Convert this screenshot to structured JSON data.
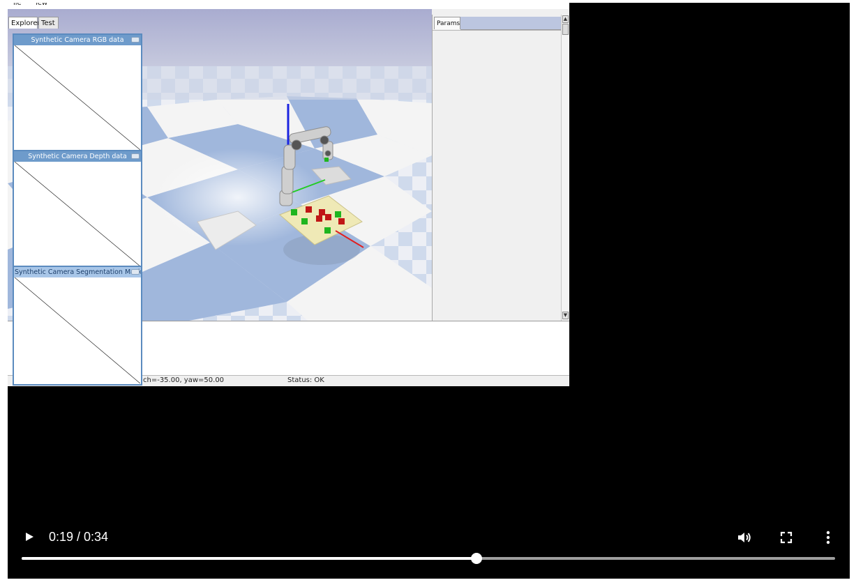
{
  "app": {
    "menu": [
      "ile",
      "iew"
    ],
    "tabs": [
      "Explorer",
      "Test"
    ],
    "params_tab": "Params",
    "status_camera": "ch=-35.00, yaw=50.00",
    "status_text": "Status: OK",
    "camera_windows": [
      {
        "title": "Synthetic Camera RGB data"
      },
      {
        "title": "Synthetic Camera Depth data"
      },
      {
        "title": "Synthetic Camera Segmentation Mask"
      }
    ]
  },
  "video": {
    "time_display": "0:19 / 0:34",
    "current_time": "0:19",
    "duration": "0:34",
    "progress_fraction": 0.559,
    "icons": {
      "play": "play-icon",
      "volume": "volume-icon",
      "fullscreen": "fullscreen-icon",
      "more": "more-vert-icon"
    }
  },
  "colors": {
    "sky": "#b3b6d3",
    "floor_blue": "#a0b7dc",
    "floor_white": "#f4f4f4",
    "tray": "#efe9b6",
    "cube_red": "#c01616",
    "cube_green": "#1fb51f",
    "axis_blue": "#1b24e0",
    "axis_green": "#22cc22",
    "axis_red": "#e02020",
    "camera_title": "#6e9bcb"
  }
}
